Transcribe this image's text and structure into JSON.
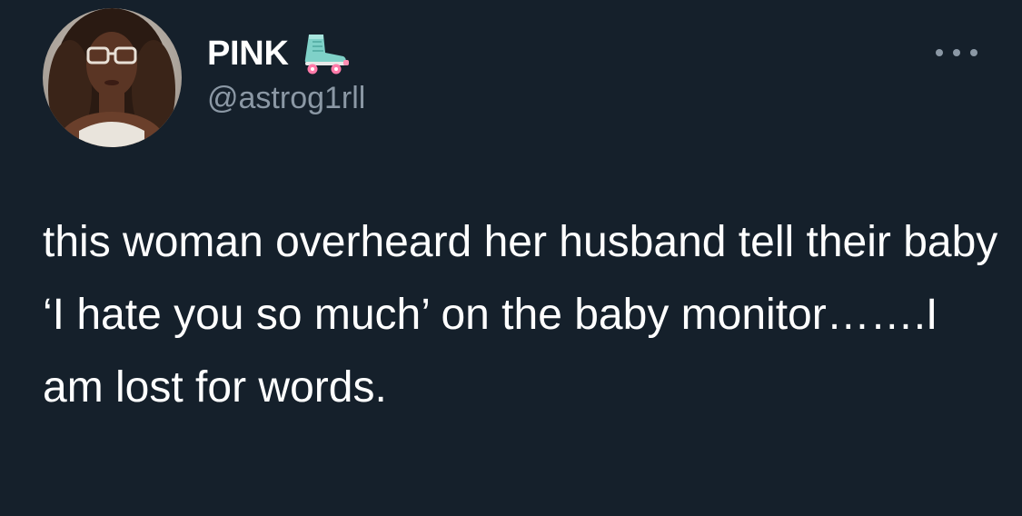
{
  "tweet": {
    "display_name": "PINK",
    "emoji_icon": "roller-skate-icon",
    "handle": "@astrog1rll",
    "more_icon": "more-options-icon",
    "text": "this woman overheard her husband tell their baby ‘I hate you so much’ on the baby monitor…….I am lost for words."
  },
  "colors": {
    "background": "#15202b",
    "text_primary": "#ffffff",
    "text_secondary": "#8b98a5"
  }
}
